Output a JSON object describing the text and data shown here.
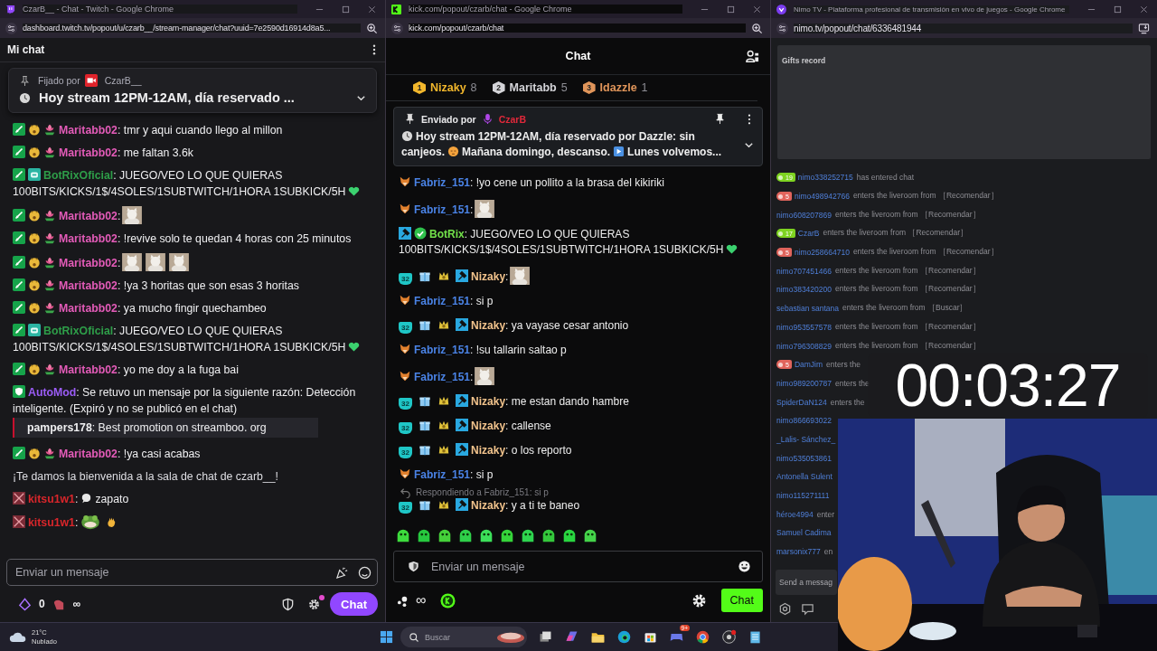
{
  "twitch_window": {
    "title": "CzarB__ - Chat - Twitch - Google Chrome",
    "url": "dashboard.twitch.tv/popout/u/czarb__/stream-manager/chat?uuid=7e2590d16914d8a5...",
    "header": "Mi chat",
    "pinned": {
      "label": "Fijado por",
      "author": "CzarB__",
      "parts": [
        {
          "kind": "clock"
        },
        {
          "kind": "text",
          "text": "Hoy stream 12PM-12AM, día reservado ..."
        }
      ]
    },
    "messages": [
      {
        "kind": "user",
        "user": "Maritabb02",
        "color": "#e35bb8",
        "parts": [
          {
            "kind": "text",
            "text": ": tmr y aqui cuando llego al millon"
          }
        ]
      },
      {
        "kind": "user",
        "user": "Maritabb02",
        "color": "#e35bb8",
        "parts": [
          {
            "kind": "text",
            "text": ": me faltan 3.6k"
          }
        ]
      },
      {
        "kind": "bot",
        "user": "BotRixOficial",
        "color": "#2e9e49",
        "parts": [
          {
            "kind": "text",
            "text": ": JUEGO/VEO LO QUE QUIERAS"
          },
          {
            "kind": "line",
            "text": "100BITS/KICKS/1$/4SOLES/1SUBTWITCH/1HORA 1SUBKICK/5H"
          },
          {
            "kind": "heart"
          }
        ]
      },
      {
        "kind": "user",
        "user": "Maritabb02",
        "color": "#e35bb8",
        "parts": [
          {
            "kind": "text",
            "text": ":"
          },
          {
            "kind": "picture"
          }
        ]
      },
      {
        "kind": "user",
        "user": "Maritabb02",
        "color": "#e35bb8",
        "parts": [
          {
            "kind": "text",
            "text": ": !revive solo te quedan 4 horas con 25 minutos"
          }
        ]
      },
      {
        "kind": "user",
        "user": "Maritabb02",
        "color": "#e35bb8",
        "parts": [
          {
            "kind": "text",
            "text": ":"
          },
          {
            "kind": "picture"
          },
          {
            "kind": "picture"
          },
          {
            "kind": "picture"
          }
        ]
      },
      {
        "kind": "user",
        "user": "Maritabb02",
        "color": "#e35bb8",
        "parts": [
          {
            "kind": "text",
            "text": ": !ya 3 horitas que son esas 3 horitas"
          }
        ]
      },
      {
        "kind": "user",
        "user": "Maritabb02",
        "color": "#e35bb8",
        "parts": [
          {
            "kind": "text",
            "text": ": ya mucho fingir quechambeo"
          }
        ]
      },
      {
        "kind": "bot",
        "user": "BotRixOficial",
        "color": "#2e9e49",
        "parts": [
          {
            "kind": "text",
            "text": ": JUEGO/VEO LO QUE QUIERAS"
          },
          {
            "kind": "line",
            "text": "100BITS/KICKS/1$/4SOLES/1SUBTWITCH/1HORA 1SUBKICK/5H"
          },
          {
            "kind": "heart"
          }
        ]
      },
      {
        "kind": "user",
        "user": "Maritabb02",
        "color": "#e35bb8",
        "parts": [
          {
            "kind": "text",
            "text": ": yo me doy a la fuga bai"
          }
        ]
      },
      {
        "kind": "automod",
        "user": "AutoMod",
        "color": "#9b5cf6",
        "parts": [
          {
            "kind": "text",
            "text": ": Se retuvo un mensaje por la siguiente razón: Detección"
          },
          {
            "kind": "line",
            "text": "inteligente. (Expiró y no se publicó en el chat)"
          }
        ],
        "held": {
          "user": "pampers178",
          "text": ": Best promotion on streamboo. org"
        }
      },
      {
        "kind": "user",
        "user": "Maritabb02",
        "color": "#e35bb8",
        "parts": [
          {
            "kind": "text",
            "text": ": !ya casi acabas"
          }
        ]
      },
      {
        "kind": "system",
        "parts": [
          {
            "kind": "text",
            "text": "¡Te damos la bienvenida a la sala de chat de czarb__!"
          }
        ]
      },
      {
        "kind": "flagged",
        "user": "kitsu1w1",
        "color": "#d9262b",
        "parts": [
          {
            "kind": "text",
            "text": ":"
          },
          {
            "kind": "speech"
          },
          {
            "kind": "text",
            "text": "zapato"
          }
        ]
      },
      {
        "kind": "flagged",
        "user": "kitsu1w1",
        "color": "#d9262b",
        "parts": [
          {
            "kind": "text",
            "text": ":"
          },
          {
            "kind": "frog"
          },
          {
            "kind": "wave"
          }
        ]
      }
    ],
    "input": {
      "placeholder": "Enviar un mensaje"
    },
    "bits": "0",
    "points": "∞",
    "settings_notification": true,
    "chat_button": "Chat"
  },
  "kick_window": {
    "title": "kick.com/popout/czarb/chat - Google Chrome",
    "url": "kick.com/popout/czarb/chat",
    "header": "Chat",
    "leaders": [
      {
        "rank": "1",
        "name": "Nizaky",
        "count": "8",
        "color": "#f2b72c"
      },
      {
        "rank": "2",
        "name": "Maritabb",
        "count": "5",
        "color": "#d4d4d8"
      },
      {
        "rank": "3",
        "name": "Idazzle",
        "count": "1",
        "color": "#e0955a"
      }
    ],
    "pinned": {
      "label": "Enviado por",
      "author": "CzarB",
      "parts": [
        {
          "kind": "clock"
        },
        {
          "kind": "text",
          "text": "Hoy stream 12PM-12AM, día reservado por Dazzle: sin"
        },
        {
          "kind": "line",
          "text": "canjeos."
        },
        {
          "kind": "sleepy"
        },
        {
          "kind": "text",
          "text": "Mañana domingo, descanso."
        },
        {
          "kind": "play"
        },
        {
          "kind": "text",
          "text": "Lunes volvemos..."
        }
      ]
    },
    "messages": [
      {
        "kind": "viewer",
        "user": "Fabriz_151",
        "color": "#4a83e6",
        "parts": [
          {
            "kind": "text",
            "text": ": !yo cene un pollito a la brasa del kikiriki"
          }
        ]
      },
      {
        "kind": "viewer",
        "user": "Fabriz_151",
        "color": "#4a83e6",
        "parts": [
          {
            "kind": "text",
            "text": ":"
          },
          {
            "kind": "picture"
          }
        ]
      },
      {
        "kind": "bot",
        "user": "BotRix",
        "color": "#72e04a",
        "parts": [
          {
            "kind": "text",
            "text": ": JUEGO/VEO LO QUE QUIERAS"
          },
          {
            "kind": "line",
            "text": "100BITS/KICKS/1$/4SOLES/1SUBTWITCH/1HORA 1SUBKICK/5H"
          },
          {
            "kind": "heart"
          }
        ]
      },
      {
        "kind": "moderator",
        "badge": "32",
        "user": "Nizaky",
        "color": "#f3c48d",
        "parts": [
          {
            "kind": "text",
            "text": ":"
          },
          {
            "kind": "picture"
          }
        ]
      },
      {
        "kind": "viewer",
        "user": "Fabriz_151",
        "color": "#4a83e6",
        "parts": [
          {
            "kind": "text",
            "text": ": si p"
          }
        ]
      },
      {
        "kind": "moderator",
        "badge": "32",
        "user": "Nizaky",
        "color": "#f3c48d",
        "parts": [
          {
            "kind": "text",
            "text": ": ya vayase cesar antonio"
          }
        ]
      },
      {
        "kind": "viewer",
        "user": "Fabriz_151",
        "color": "#4a83e6",
        "parts": [
          {
            "kind": "text",
            "text": ": !su tallarin saltao p"
          }
        ]
      },
      {
        "kind": "viewer",
        "user": "Fabriz_151",
        "color": "#4a83e6",
        "parts": [
          {
            "kind": "text",
            "text": ":"
          },
          {
            "kind": "picture"
          }
        ]
      },
      {
        "kind": "moderator",
        "badge": "32",
        "user": "Nizaky",
        "color": "#f3c48d",
        "parts": [
          {
            "kind": "text",
            "text": ": me estan dando hambre"
          }
        ]
      },
      {
        "kind": "moderator",
        "badge": "32",
        "user": "Nizaky",
        "color": "#f3c48d",
        "parts": [
          {
            "kind": "text",
            "text": ": callense"
          }
        ]
      },
      {
        "kind": "moderator",
        "badge": "32",
        "user": "Nizaky",
        "color": "#f3c48d",
        "parts": [
          {
            "kind": "text",
            "text": ": o los reporto"
          }
        ]
      },
      {
        "kind": "viewer",
        "user": "Fabriz_151",
        "color": "#4a83e6",
        "parts": [
          {
            "kind": "text",
            "text": ": si p"
          }
        ]
      },
      {
        "kind": "moderator",
        "badge": "32",
        "reply": "Respondiendo a Fabriz_151: si p",
        "user": "Nizaky",
        "color": "#f3c48d",
        "parts": [
          {
            "kind": "text",
            "text": ": y a ti te baneo"
          }
        ]
      }
    ],
    "input": {
      "placeholder": "Enviar un mensaje"
    },
    "points": "∞",
    "chat_button": "Chat"
  },
  "nimo_window": {
    "title": "Nimo TV - Plataforma profesional de transmisión en vivo de juegos - Google Chrome",
    "url": "nimo.tv/popout/chat/6336481944",
    "gifts_title": "Gifts record",
    "rows": [
      {
        "badge": {
          "text": "19",
          "color": "#7ed321"
        },
        "user": "nimo338252715",
        "text": "has entered chat"
      },
      {
        "badge": {
          "text": "5",
          "color": "#e0645c"
        },
        "user": "nimo498942766",
        "text": "enters the liveroom from ［Recomendar］"
      },
      {
        "user": "nimo608207869",
        "text": "enters the liveroom from ［Recomendar］"
      },
      {
        "badge": {
          "text": "17",
          "color": "#7ed321"
        },
        "user": "CzarB",
        "text": "enters the liveroom from ［Recomendar］"
      },
      {
        "badge": {
          "text": "5",
          "color": "#e0645c"
        },
        "user": "nimo258664710",
        "text": "enters the liveroom from ［Recomendar］"
      },
      {
        "user": "nimo707451466",
        "text": "enters the liveroom from ［Recomendar］"
      },
      {
        "user": "nimo383420200",
        "text": "enters the liveroom from ［Recomendar］"
      },
      {
        "user": "sebastian santana",
        "text": "enters the liveroom from ［Buscar］"
      },
      {
        "user": "nimo953557578",
        "text": "enters the liveroom from ［Recomendar］"
      },
      {
        "user": "nimo796308829",
        "text": "enters the liveroom from ［Recomendar］"
      },
      {
        "badge": {
          "text": "5",
          "color": "#e0645c"
        },
        "user": "DamJim",
        "text": "enters the"
      },
      {
        "user": "nimo989200787",
        "text": "enters the"
      },
      {
        "user": "SpiderDaN124",
        "text": "enters the"
      },
      {
        "user": "nimo866693022"
      },
      {
        "user": "_Lalis- Sánchez_"
      },
      {
        "user": "nimo535053861"
      },
      {
        "user": "Antonella Sulent"
      },
      {
        "user": "nimo115271111"
      },
      {
        "user": "héroe4994",
        "text": "enter"
      },
      {
        "user": "Samuel Cadima"
      },
      {
        "user": "marsonix777",
        "text": "en"
      }
    ],
    "input": {
      "placeholder": "Send a messag"
    }
  },
  "timer_overlay": {
    "time": "00:03:27"
  },
  "webcam": {
    "kind": "picture"
  },
  "taskbar": {
    "temperature": "21°C",
    "weather": "Nublado",
    "search": {
      "placeholder": "Buscar"
    },
    "chat_app_badge": "9+"
  }
}
